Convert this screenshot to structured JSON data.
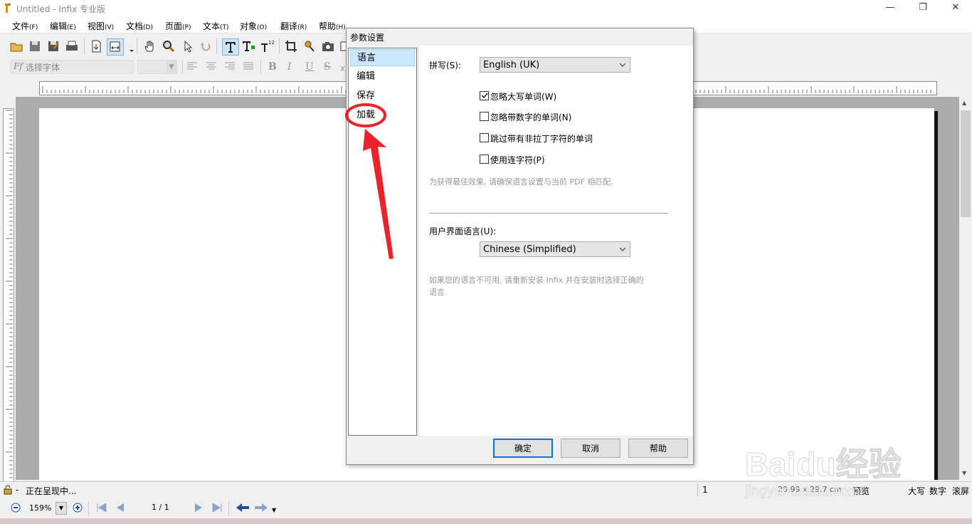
{
  "window": {
    "title": "Untitled - Infix 专业版"
  },
  "menu": [
    {
      "label": "文件",
      "key": "(F)"
    },
    {
      "label": "编辑",
      "key": "(E)"
    },
    {
      "label": "视图",
      "key": "(V)"
    },
    {
      "label": "文档",
      "key": "(D)"
    },
    {
      "label": "页面",
      "key": "(P)"
    },
    {
      "label": "文本",
      "key": "(T)"
    },
    {
      "label": "对象",
      "key": "(O)"
    },
    {
      "label": "翻译",
      "key": "(R)"
    },
    {
      "label": "帮助",
      "key": "(H)"
    }
  ],
  "format_toolbar": {
    "font_placeholder": "选择字体",
    "bold": "B",
    "italic": "I",
    "underline": "U",
    "strike": "S"
  },
  "statusbar": {
    "status": "正在呈现中...",
    "page": "1",
    "size": "20.99 x 29.7 cm",
    "preview": "预览",
    "caps": "大写",
    "num": "数字",
    "scroll": "滚屏"
  },
  "navbar": {
    "zoom": "159%",
    "page_of": "1 / 1"
  },
  "dialog": {
    "title": "参数设置",
    "nav": [
      "语言",
      "编辑",
      "保存",
      "加载"
    ],
    "selected_nav": "语言",
    "spell_label": "拼写(S):",
    "spell_value": "English (UK)",
    "options": [
      {
        "label": "忽略大写单词(W)",
        "checked": true
      },
      {
        "label": "忽略带数字的单词(N)",
        "checked": false
      },
      {
        "label": "跳过带有非拉丁字符的单词",
        "checked": false
      },
      {
        "label": "使用连字符(P)",
        "checked": false
      }
    ],
    "hint1": "为获得最佳效果, 请确保语言设置与当前 PDF 相匹配.",
    "ui_lang_label": "用户界面语言(U):",
    "ui_lang_value": "Chinese (Simplified)",
    "hint2_line1": "如果您的语言不可用, 请重新安装 Infix 并在安装时选择正确的",
    "hint2_line2": "语言.",
    "buttons": {
      "ok": "确定",
      "cancel": "取消",
      "help": "帮助"
    }
  },
  "colors": {
    "annotation": "#e8242a",
    "selection": "#cce8ff",
    "default_button_border": "#0078d7"
  },
  "watermark": {
    "brand": "Baidu经验",
    "url": "jingyan.baidu.com"
  }
}
